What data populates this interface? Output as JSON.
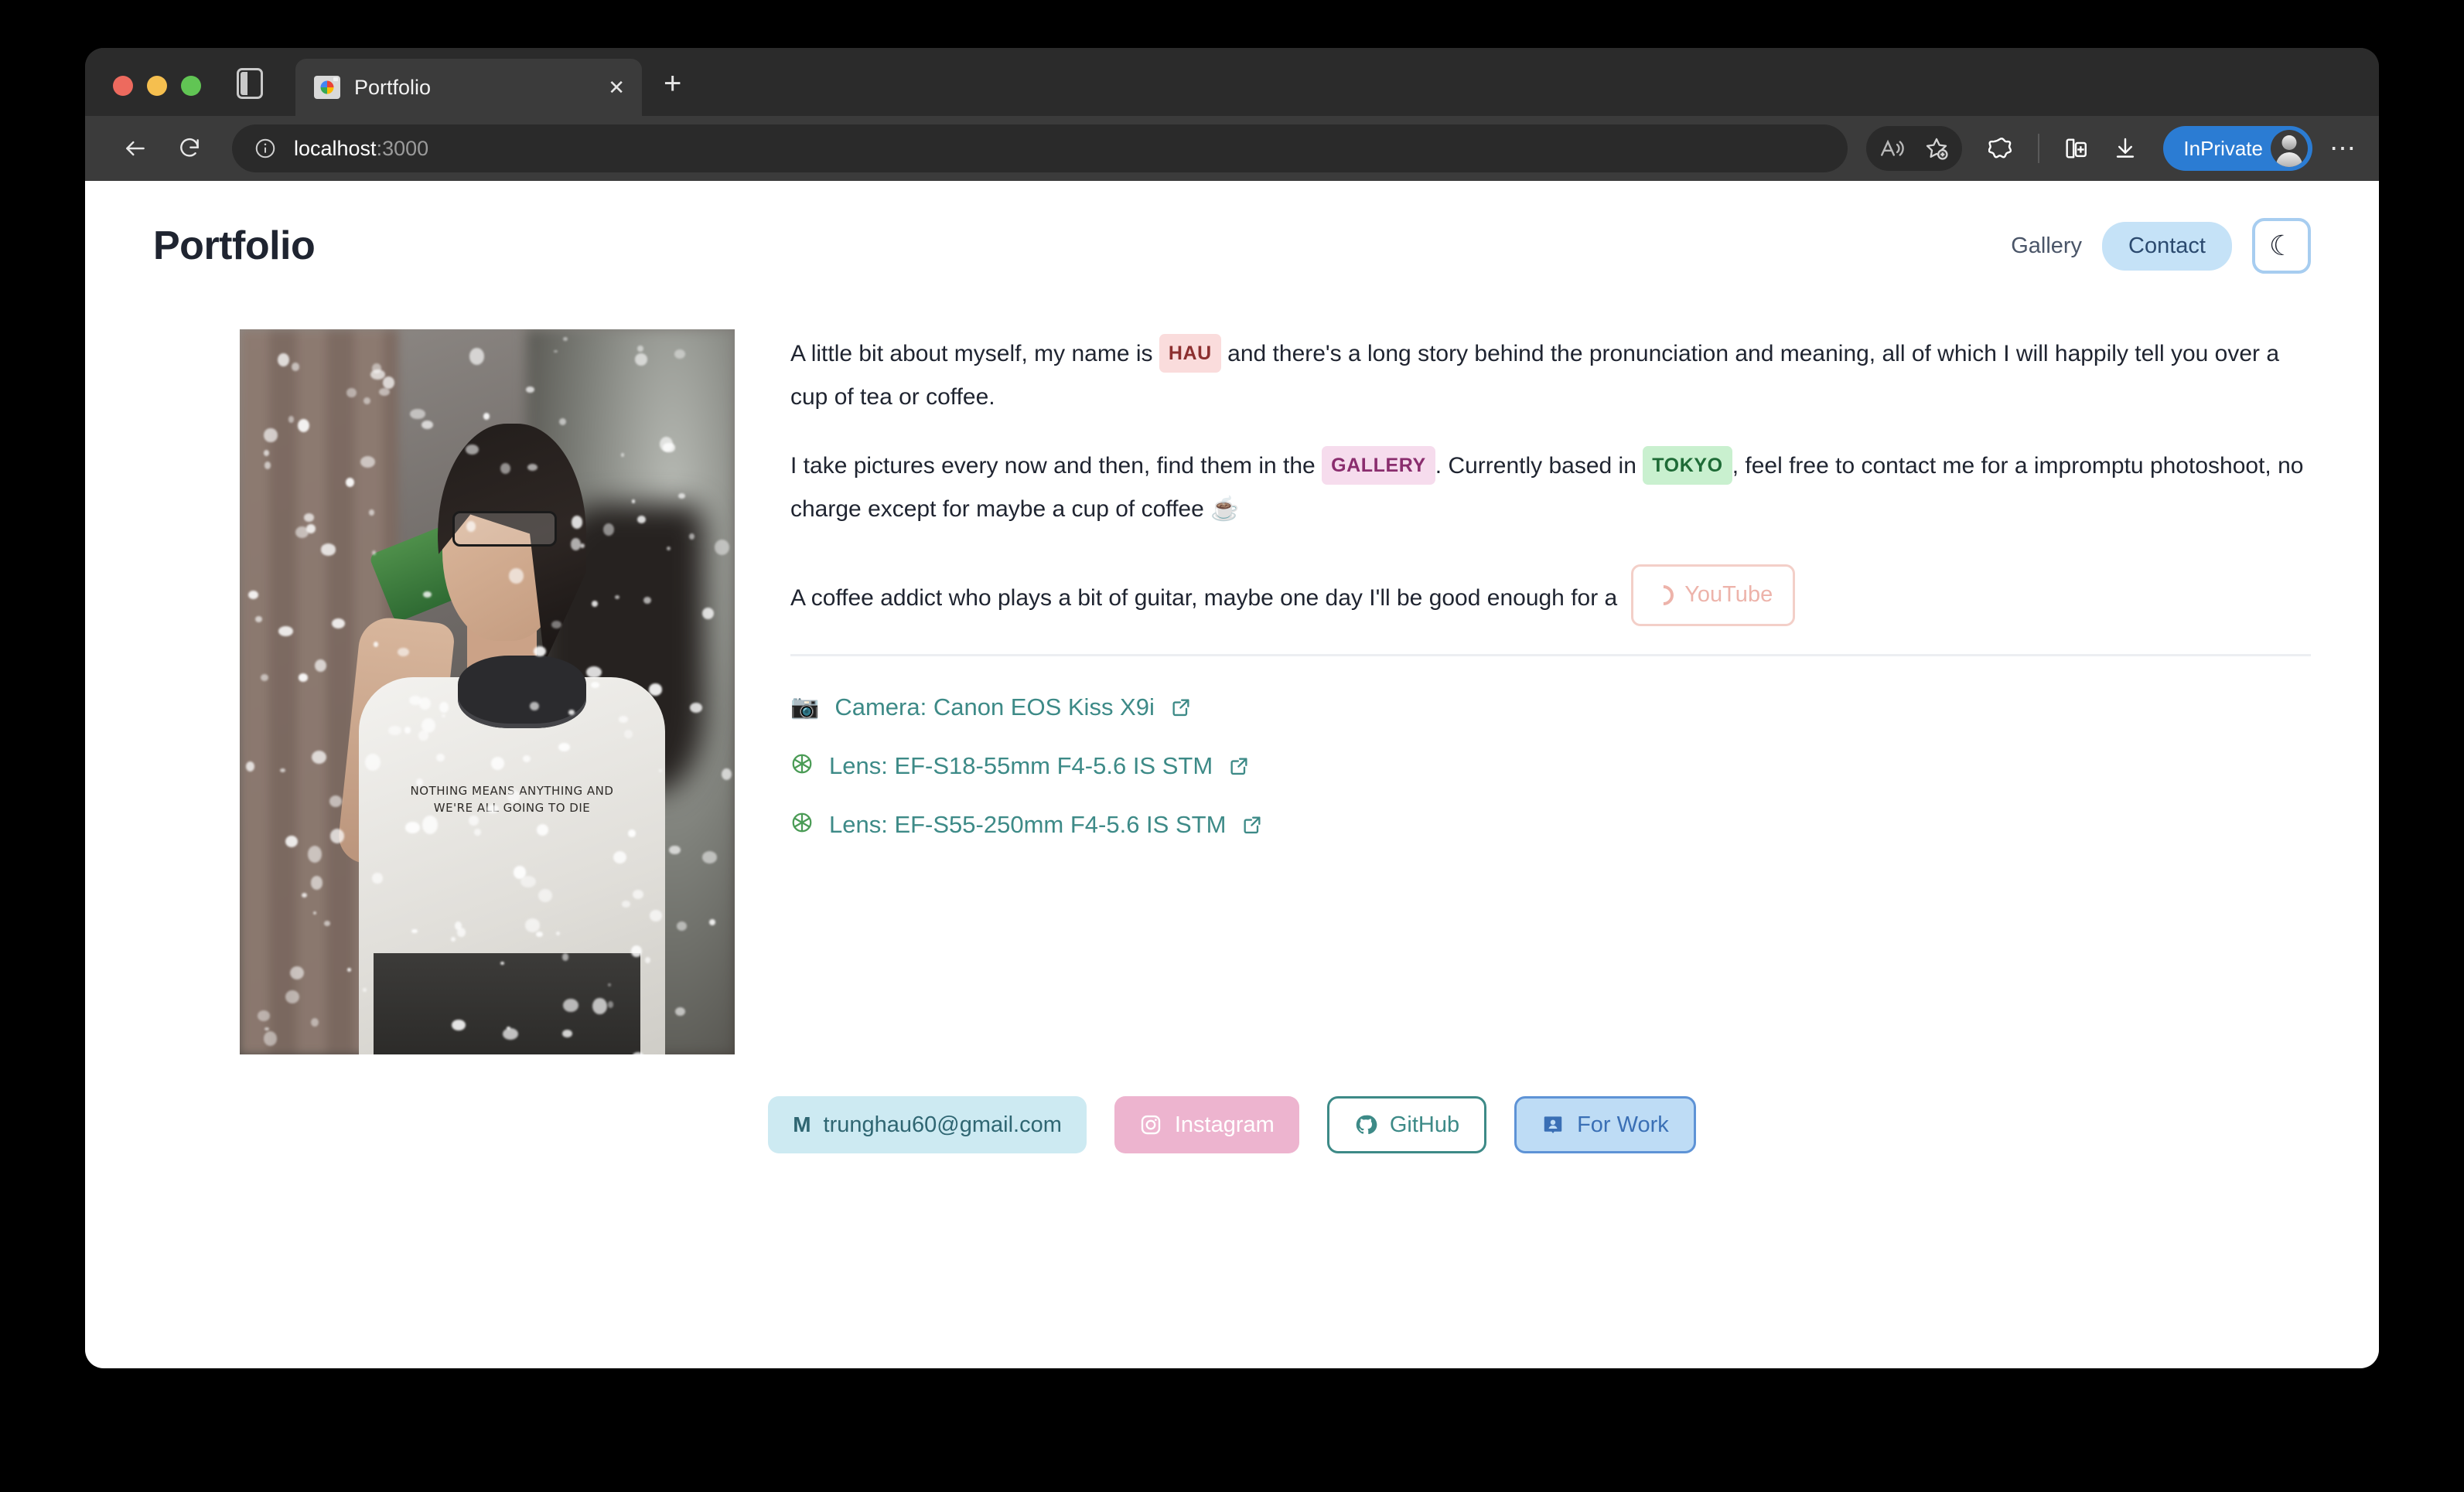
{
  "browser": {
    "tab": {
      "title": "Portfolio",
      "favicon": "camera-favicon",
      "close_label": "✕"
    },
    "new_tab_label": "+",
    "address": {
      "host": "localhost",
      "port": ":3000",
      "info_icon": "info-icon"
    },
    "toolbar_icons": [
      "read-aloud-icon",
      "add-favorite-icon",
      "copilot-icon",
      "split-screen-icon",
      "downloads-icon"
    ],
    "profile": {
      "label": "InPrivate",
      "avatar": "user-avatar"
    },
    "more_menu_label": "⋯",
    "back_icon": "back-arrow-icon",
    "reload_icon": "reload-icon",
    "sidebar_icon": "sidebar-toggle-icon"
  },
  "site": {
    "title": "Portfolio",
    "nav": {
      "gallery": "Gallery",
      "contact": "Contact",
      "theme_toggle_icon": "moon-icon",
      "moon_glyph": "☾"
    }
  },
  "about": {
    "p1_before": "A little bit about myself, my name is ",
    "p1_tag": "HAU",
    "p1_after": " and there's a long story behind the pronunciation and meaning, all of which I will happily tell you over a cup of tea or coffee.",
    "p2_before": "I take pictures every now and then, find them in the ",
    "p2_tag_gallery": "GALLERY",
    "p2_mid": ". Currently based in ",
    "p2_tag_tokyo": "TOKYO",
    "p2_after": ", feel free to contact me for a impromptu photoshoot, no charge except for maybe a cup of coffee ☕",
    "p3": "A coffee addict who plays a bit of guitar, maybe one day I'll be good enough for a",
    "youtube_chip": "YouTube"
  },
  "gear": [
    {
      "icon": "camera-emoji",
      "glyph": "📷",
      "label": "Camera: Canon EOS Kiss X9i"
    },
    {
      "icon": "aperture-emoji",
      "glyph": "❂",
      "label": "Lens: EF-S18-55mm F4-5.6 IS STM"
    },
    {
      "icon": "aperture-emoji",
      "glyph": "❂",
      "label": "Lens: EF-S55-250mm F4-5.6 IS STM"
    }
  ],
  "social": [
    {
      "name": "email",
      "icon": "gmail-icon",
      "label": "trunghau60@gmail.com"
    },
    {
      "name": "instagram",
      "icon": "instagram-icon",
      "label": "Instagram"
    },
    {
      "name": "github",
      "icon": "github-icon",
      "label": "GitHub"
    },
    {
      "name": "forwork",
      "icon": "contact-card-icon",
      "label": "For Work"
    }
  ],
  "photo": {
    "alt": "portrait-in-snow",
    "shirt_text": "NOTHING MEANS ANYTHING AND WE'RE ALL GOING TO DIE"
  },
  "colors": {
    "accent_blue": "#2b7cd3",
    "contact_pill": "#c5e2f7",
    "teal": "#3d8a87",
    "tag_name_bg": "#fadcdc",
    "tag_gallery_bg": "#f6dced",
    "tag_tokyo_bg": "#c9f0cf"
  }
}
